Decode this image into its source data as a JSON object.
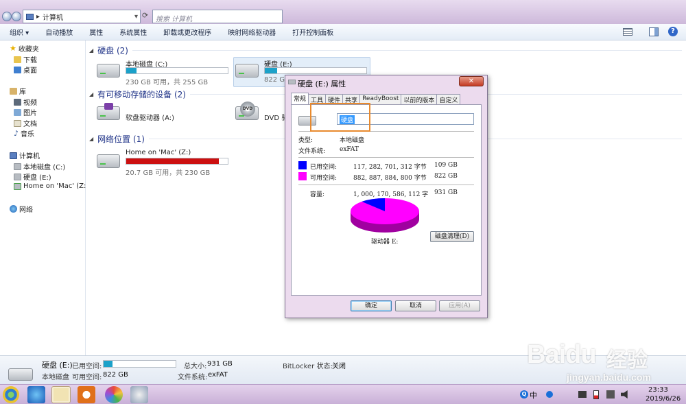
{
  "window": {
    "address": "计算机",
    "search_placeholder": "搜索 计算机"
  },
  "toolbar": {
    "items": [
      "组织 ▾",
      "自动播放",
      "属性",
      "系统属性",
      "卸载或更改程序",
      "映射网络驱动器",
      "打开控制面板"
    ]
  },
  "sidebar": {
    "favorites": "收藏夹",
    "downloads": "下载",
    "desktop": "桌面",
    "libraries": "库",
    "videos": "视频",
    "pictures": "图片",
    "documents": "文档",
    "music": "音乐",
    "computer": "计算机",
    "local_disk_c": "本地磁盘 (C:)",
    "disk_e": "硬盘 (E:)",
    "home_mac": "Home on 'Mac' (Z:)",
    "network": "网络"
  },
  "content": {
    "hdd_section": "硬盘 (2)",
    "removable_section": "有可移动存储的设备 (2)",
    "network_section": "网络位置 (1)",
    "drives": [
      {
        "name": "本地磁盘 (C:)",
        "free": "230 GB 可用，共 255 GB",
        "used_fraction": 0.1,
        "color": "#1ba1c9"
      },
      {
        "name": "硬盘 (E:)",
        "free": "822 GB",
        "used_fraction": 0.12,
        "color": "#1ba1c9"
      }
    ],
    "floppy": "软盘驱动器 (A:)",
    "dvd": "DVD 驱",
    "dvd_badge": "DVD",
    "network_drive": {
      "name": "Home on 'Mac' (Z:)",
      "free": "20.7 GB 可用，共 230 GB",
      "used_fraction": 0.91,
      "color": "#cc1010"
    }
  },
  "dialog": {
    "title": "硬盘 (E:) 属性",
    "close": "✕",
    "tabs": [
      "常规",
      "工具",
      "硬件",
      "共享",
      "ReadyBoost",
      "以前的版本",
      "自定义"
    ],
    "name_value": "硬盘",
    "type_label": "类型:",
    "type_value": "本地磁盘",
    "fs_label": "文件系统:",
    "fs_value": "exFAT",
    "used_label": "已用空间:",
    "used_bytes": "117, 282, 701, 312 字节",
    "used_gb": "109 GB",
    "free_label": "可用空间:",
    "free_bytes": "882, 887, 884, 800 字节",
    "free_gb": "822 GB",
    "capacity_label": "容量:",
    "capacity_bytes": "1, 000, 170, 586, 112 字",
    "capacity_gb": "931 GB",
    "used_fraction": 0.117,
    "used_color": "#0000ff",
    "free_color": "#ff00ff",
    "drive_label": "驱动器 E:",
    "cleanup_button": "磁盘清理(D)",
    "ok": "确定",
    "cancel": "取消",
    "apply": "应用(A)"
  },
  "statusbar": {
    "drive_name": "硬盘 (E:)",
    "used_label": "已用空间:",
    "used_fraction": 0.12,
    "type": "本地磁盘",
    "free_label": "可用空间:",
    "free_value": "822 GB",
    "total_label": "总大小:",
    "total_value": "931 GB",
    "fs_label": "文件系统:",
    "fs_value": "exFAT",
    "bitlocker_label": "BitLocker 状态:",
    "bitlocker_value": "关闭"
  },
  "taskbar": {
    "time": "23:33",
    "date": "2019/6/26",
    "ime": "中"
  },
  "watermark": {
    "brand": "Baidu",
    "cn": "经验",
    "url": "jingyan.baidu.com"
  }
}
